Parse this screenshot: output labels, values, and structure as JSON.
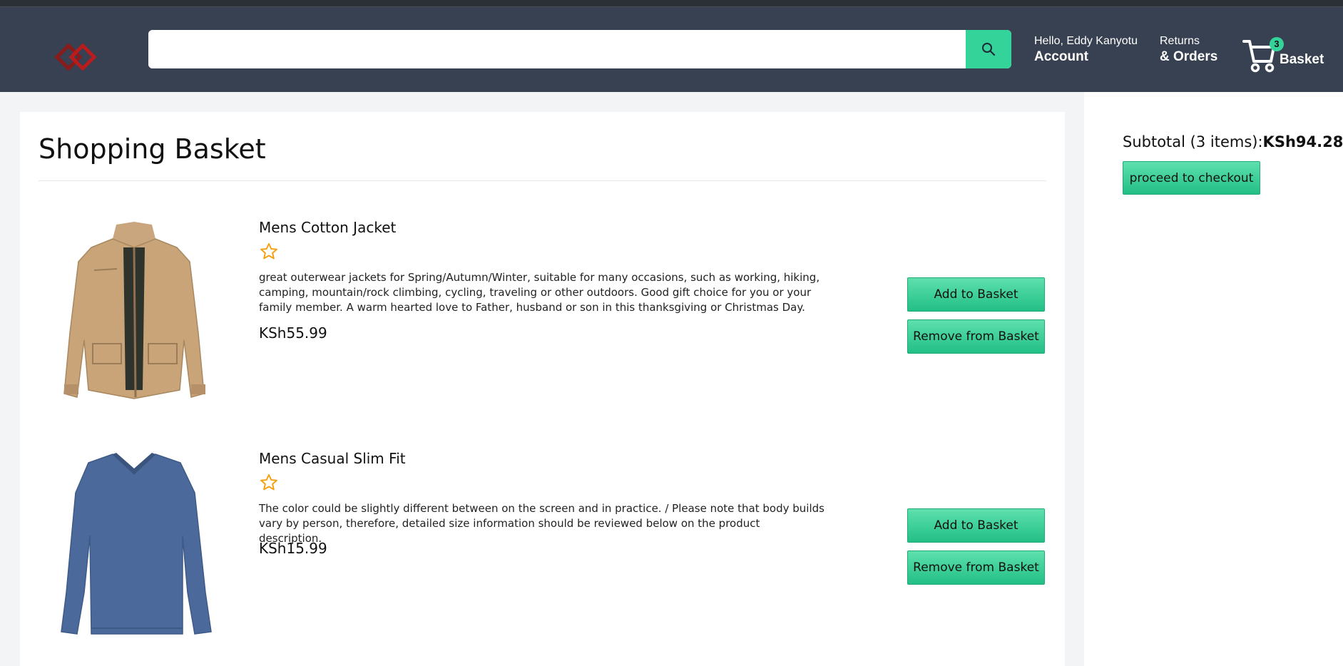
{
  "header": {
    "logo_icon": "diamond-logo-icon",
    "search": {
      "placeholder": "",
      "button_icon": "search-icon"
    },
    "account": {
      "greeting": "Hello, Eddy Kanyotu",
      "label": "Account"
    },
    "orders": {
      "line1": "Returns",
      "line2": "& Orders"
    },
    "basket": {
      "count": "3",
      "label": "Basket",
      "icon": "cart-icon"
    }
  },
  "main": {
    "title": "Shopping Basket",
    "items": [
      {
        "title": "Mens Cotton Jacket",
        "rating_icon": "star-outline-icon",
        "description": "great outerwear jackets for Spring/Autumn/Winter, suitable for many occasions, such as working, hiking, camping, mountain/rock climbing, cycling, traveling or other outdoors. Good gift choice for you or your family member. A warm hearted love to Father, husband or son in this thanksgiving or Christmas Day.",
        "price": "KSh55.99",
        "add_label": "Add to Basket",
        "remove_label": "Remove from Basket"
      },
      {
        "title": "Mens Casual Slim Fit",
        "rating_icon": "star-outline-icon",
        "description": "The color could be slightly different between on the screen and in practice. / Please note that body builds vary by person, therefore, detailed size information should be reviewed below on the product description.",
        "price": "KSh15.99",
        "add_label": "Add to Basket",
        "remove_label": "Remove from Basket"
      }
    ]
  },
  "sidebar": {
    "subtotal_label": "Subtotal (3 items):",
    "subtotal_value": "KSh94.28",
    "checkout_label": "proceed to checkout"
  },
  "colors": {
    "header_bg": "#374151",
    "accent": "#34d399",
    "logo": "#b91c1c",
    "star": "#f59e0b"
  }
}
